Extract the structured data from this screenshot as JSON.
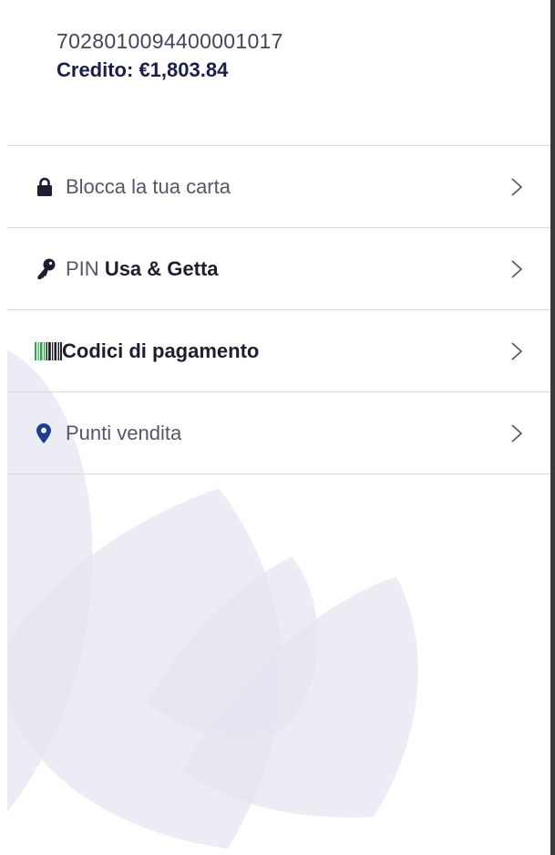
{
  "account": {
    "card_number": "7028010094400001017",
    "credit_label": "Credito: €1,803.84"
  },
  "menu": {
    "items": [
      {
        "icon": "lock-icon",
        "label": "Blocca la tua carta"
      },
      {
        "icon": "key-icon",
        "label_prefix": "PIN",
        "label_bold": "Usa & Getta"
      },
      {
        "icon": "barcode-icon",
        "label": "Codici di pagamento"
      },
      {
        "icon": "location-pin-icon",
        "label": "Punti vendita"
      }
    ]
  },
  "colors": {
    "brand": "#1a1f4a",
    "pin_icon": "#1f3b8c",
    "decoration": "#e6e7f1"
  }
}
